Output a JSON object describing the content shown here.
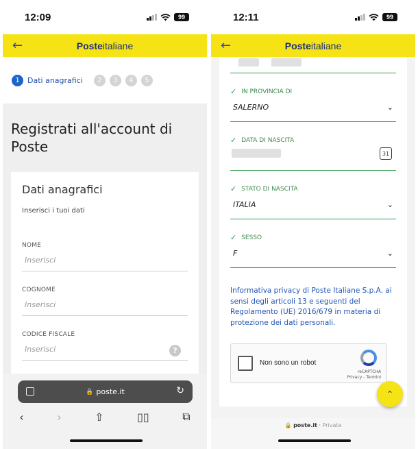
{
  "left": {
    "status": {
      "time": "12:09",
      "battery": "99"
    },
    "header": {
      "back_icon": "arrow-left-icon",
      "logo_bold": "Poste",
      "logo_light": "italiane"
    },
    "stepper": {
      "steps": [
        "1",
        "2",
        "3",
        "4",
        "5"
      ],
      "active_label": "Dati anagrafici"
    },
    "page_title": "Registrati all'account di Poste",
    "card": {
      "title": "Dati anagrafici",
      "subtitle": "Inserisci i tuoi dati",
      "fields": [
        {
          "label": "NOME",
          "placeholder": "Inserisci"
        },
        {
          "label": "COGNOME",
          "placeholder": "Inserisci"
        },
        {
          "label": "CODICE FISCALE",
          "placeholder": "Inserisci",
          "help": "?"
        }
      ]
    },
    "safari": {
      "url": "poste.it",
      "lock_icon": "lock-icon",
      "nav": [
        "‹",
        "›",
        "share-icon",
        "bookmarks-icon",
        "tabs-icon"
      ]
    }
  },
  "right": {
    "status": {
      "time": "12:11",
      "battery": "99"
    },
    "header": {
      "back_icon": "arrow-left-icon",
      "logo_bold": "Poste",
      "logo_light": "italiane"
    },
    "fields": [
      {
        "label": "IN PROVINCIA DI",
        "value": "SALERNO",
        "control": "chevron-down-icon"
      },
      {
        "label": "DATA DI NASCITA",
        "value": "",
        "control": "calendar-icon",
        "calendar_day": "31"
      },
      {
        "label": "STATO DI NASCITA",
        "value": "ITALIA",
        "control": "chevron-down-icon"
      },
      {
        "label": "SESSO",
        "value": "F",
        "control": "chevron-down-icon"
      }
    ],
    "privacy_text": "Informativa privacy di Poste Italiane S.p.A. ai sensi degli articoli 13 e seguenti del Regolamento (UE) 2016/679 in materia di protezione dei dati personali.",
    "recaptcha": {
      "label": "Non sono un robot",
      "brand": "reCAPTCHA",
      "links": "Privacy - Termini"
    },
    "footer": {
      "url": "poste.it",
      "mode": "Privata"
    }
  },
  "colors": {
    "accent_yellow": "#f5e315",
    "brand_blue": "#1d2f7d",
    "valid_green": "#2e9a4a",
    "link_blue": "#1f56b5"
  }
}
